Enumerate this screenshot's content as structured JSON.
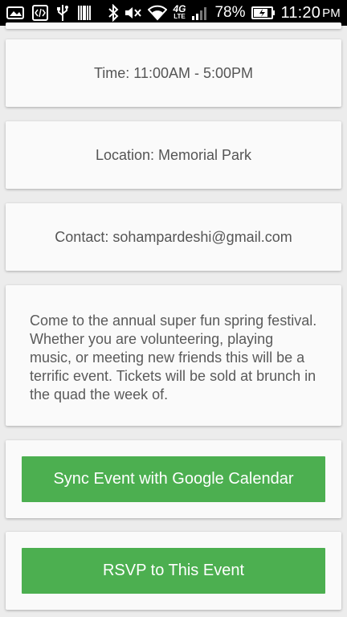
{
  "status_bar": {
    "battery_percent": "78%",
    "time": "11:20",
    "meridiem": "PM",
    "network_label": "4G",
    "network_sub": "LTE",
    "icons": [
      "image-icon",
      "code-icon",
      "usb-icon",
      "barcode-icon",
      "bluetooth-icon",
      "mute-icon",
      "wifi-icon",
      "lte-icon",
      "signal-icon",
      "battery-charging-icon"
    ]
  },
  "event": {
    "time": "Time: 11:00AM - 5:00PM",
    "location": "Location: Memorial Park",
    "contact": "Contact: sohampardeshi@gmail.com",
    "description": "Come to the annual super fun spring festival. Whether you are volunteering, playing music, or meeting new friends this will be a terrific event. Tickets will be sold at brunch in the quad the week of."
  },
  "actions": {
    "sync_label": "Sync Event with Google Calendar",
    "rsvp_label": "RSVP to This Event"
  },
  "colors": {
    "accent": "#4caf50",
    "card": "#fafafa",
    "background": "#ececec"
  }
}
